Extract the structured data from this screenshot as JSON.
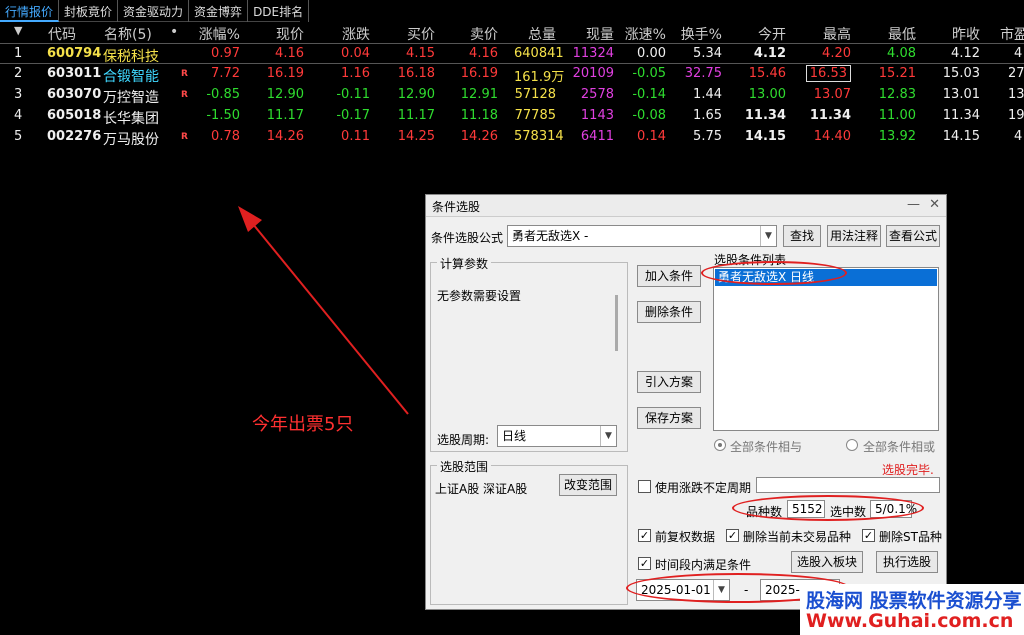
{
  "tabs": [
    "行情报价",
    "封板竟价",
    "资金驱动力",
    "资金博弈",
    "DDE排名"
  ],
  "table": {
    "headers": {
      "sort": "▼",
      "code": "代码",
      "name": "称(5)",
      "name_prefix": "名",
      "dot": "•",
      "pct": "涨幅%",
      "price": "现价",
      "chg": "涨跌",
      "bid": "买价",
      "ask": "卖价",
      "vol": "总量",
      "cur": "现量",
      "speed": "涨速%",
      "turn": "换手%",
      "open": "今开",
      "high": "最高",
      "low": "最低",
      "prev": "昨收",
      "mkt": "市盈"
    },
    "rows": [
      {
        "idx": "1",
        "code": "600794",
        "name": "保税科技",
        "badge": "",
        "pct": "0.97",
        "price": "4.16",
        "chg": "0.04",
        "bid": "4.15",
        "ask": "4.16",
        "vol": "640841",
        "cur": "11324",
        "speed": "0.00",
        "turn": "5.34",
        "open": "4.12",
        "high": "4.20",
        "low": "4.08",
        "prev": "4.12",
        "mkt": "4"
      },
      {
        "idx": "2",
        "code": "603011",
        "name": "合锻智能",
        "badge": "R",
        "pct": "7.72",
        "price": "16.19",
        "chg": "1.16",
        "bid": "16.18",
        "ask": "16.19",
        "vol": "161.9万",
        "cur": "20109",
        "speed": "-0.05",
        "turn": "32.75",
        "open": "15.46",
        "high": "16.53",
        "low": "15.21",
        "prev": "15.03",
        "mkt": "27"
      },
      {
        "idx": "3",
        "code": "603070",
        "name": "万控智造",
        "badge": "R",
        "pct": "-0.85",
        "price": "12.90",
        "chg": "-0.11",
        "bid": "12.90",
        "ask": "12.91",
        "vol": "57128",
        "cur": "2578",
        "speed": "-0.14",
        "turn": "1.44",
        "open": "13.00",
        "high": "13.07",
        "low": "12.83",
        "prev": "13.01",
        "mkt": "13"
      },
      {
        "idx": "4",
        "code": "605018",
        "name": "长华集团",
        "badge": "",
        "pct": "-1.50",
        "price": "11.17",
        "chg": "-0.17",
        "bid": "11.17",
        "ask": "11.18",
        "vol": "77785",
        "cur": "1143",
        "speed": "-0.08",
        "turn": "1.65",
        "open": "11.34",
        "high": "11.34",
        "low": "11.00",
        "prev": "11.34",
        "mkt": "19"
      },
      {
        "idx": "5",
        "code": "002276",
        "name": "万马股份",
        "badge": "R",
        "pct": "0.78",
        "price": "14.26",
        "chg": "0.11",
        "bid": "14.25",
        "ask": "14.26",
        "vol": "578314",
        "cur": "6411",
        "speed": "0.14",
        "turn": "5.75",
        "open": "14.15",
        "high": "14.40",
        "low": "13.92",
        "prev": "14.15",
        "mkt": "4"
      }
    ]
  },
  "annotation": "今年出票5只",
  "dialog": {
    "title": "条件选股",
    "formula_label": "条件选股公式",
    "formula_value": "勇者无敌选X  -",
    "btn_find": "查找",
    "btn_usage": "用法注释",
    "btn_view": "查看公式",
    "params_group": "计算参数",
    "params_text": "无参数需要设置",
    "btn_add": "加入条件",
    "btn_delete": "删除条件",
    "btn_import": "引入方案",
    "btn_save": "保存方案",
    "list_label": "选股条件列表",
    "list_item": "勇者无敌选X  日线",
    "period_label": "选股周期:",
    "period_value": "日线",
    "radio_and": "全部条件相与",
    "radio_or": "全部条件相或",
    "status": "选股完毕.",
    "range_group": "选股范围",
    "range_text": "上证A股 深证A股",
    "btn_range": "改变范围",
    "chk_uncertain": "使用涨跌不定周期",
    "count_label": "品种数",
    "count_value": "5152",
    "selected_label": "选中数",
    "selected_value": "5/0.1%",
    "chk_fq": "前复权数据",
    "chk_del_notrade": "删除当前未交易品种",
    "chk_del_st": "删除ST品种",
    "chk_period": "时间段内满足条件",
    "btn_to_block": "选股入板块",
    "btn_execute": "执行选股",
    "date_start": "2025-01-01",
    "date_sep": "-",
    "date_end": "2025-05"
  },
  "watermark": {
    "line1": "股海网 股票软件资源分享",
    "line2": "Www.Guhai.com.cn"
  }
}
